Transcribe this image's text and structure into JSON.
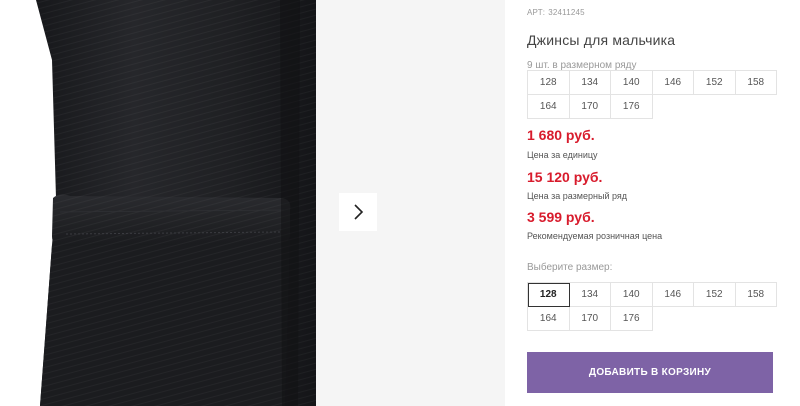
{
  "product": {
    "article_label": "АРТ:",
    "article_number": "32411245",
    "title": "Джинсы для мальчика"
  },
  "size_range": {
    "label": "9 шт. в размерном ряду",
    "sizes": [
      "128",
      "134",
      "140",
      "146",
      "152",
      "158",
      "164",
      "170",
      "176"
    ]
  },
  "prices": [
    {
      "amount": "1 680 руб.",
      "caption": "Цена за единицу"
    },
    {
      "amount": "15 120 руб.",
      "caption": "Цена за размерный ряд"
    },
    {
      "amount": "3 599 руб.",
      "caption": "Рекомендуемая розничная цена"
    }
  ],
  "size_select": {
    "label": "Выберите размер:",
    "sizes": [
      "128",
      "134",
      "140",
      "146",
      "152",
      "158",
      "164",
      "170",
      "176"
    ],
    "selected": "128"
  },
  "cart": {
    "add_label": "ДОБАВИТЬ В КОРЗИНУ"
  },
  "gallery": {
    "next_icon": "chevron-right-icon"
  },
  "colors": {
    "price": "#d81b2c",
    "button": "#7e63a6",
    "denim": "#1e1f22"
  }
}
